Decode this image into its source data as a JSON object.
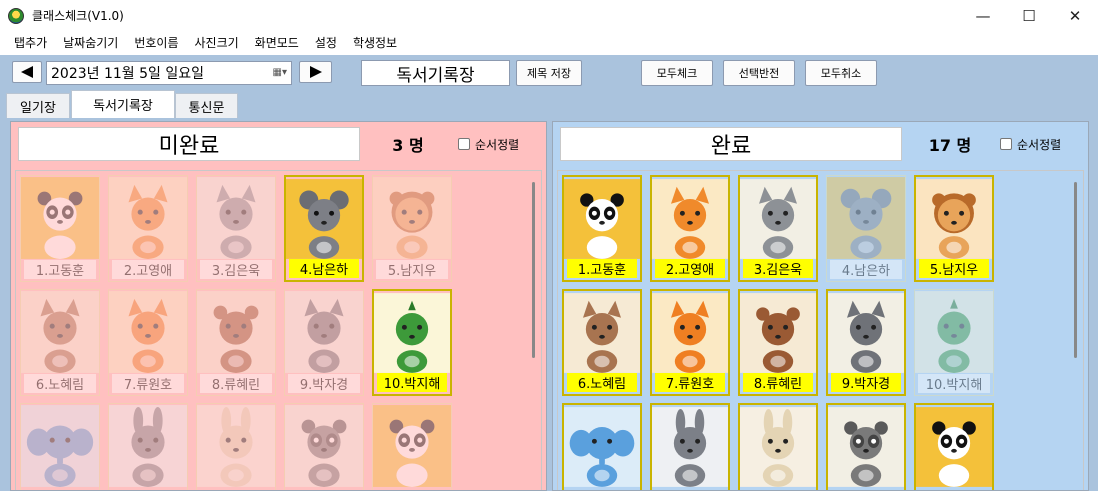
{
  "window": {
    "title": "클래스체크(V1.0)"
  },
  "menu": [
    "탭추가",
    "날짜숨기기",
    "번호이름",
    "사진크기",
    "화면모드",
    "설정",
    "학생정보"
  ],
  "toolbar": {
    "date": "2023년 11월   5일  일요일",
    "title_field": "독서기록장",
    "save_title": "제목 저장",
    "check_all": "모두체크",
    "invert": "선택반전",
    "cancel_all": "모두취소"
  },
  "tabs": [
    "일기장",
    "독서기록장",
    "통신문"
  ],
  "incomplete": {
    "label": "미완료",
    "count": "3 명",
    "sort_label": "순서정렬",
    "cards": [
      {
        "name": "1.고동훈",
        "animal": "panda",
        "checked": false
      },
      {
        "name": "2.고영애",
        "animal": "cat-orange",
        "checked": false
      },
      {
        "name": "3.김은욱",
        "animal": "cat-gray",
        "checked": false
      },
      {
        "name": "4.남은하",
        "animal": "koala",
        "checked": true
      },
      {
        "name": "5.남지우",
        "animal": "lion",
        "checked": false
      },
      {
        "name": "6.노혜림",
        "animal": "squirrel",
        "checked": false
      },
      {
        "name": "7.류원호",
        "animal": "fox",
        "checked": false
      },
      {
        "name": "8.류혜린",
        "animal": "chipmunk",
        "checked": false
      },
      {
        "name": "9.박자경",
        "animal": "wolf",
        "checked": false
      },
      {
        "name": "10.박지해",
        "animal": "dino",
        "checked": true
      },
      {
        "name": "",
        "animal": "elephant",
        "checked": false
      },
      {
        "name": "",
        "animal": "rabbit",
        "checked": false
      },
      {
        "name": "",
        "animal": "rabbit-tan",
        "checked": false
      },
      {
        "name": "",
        "animal": "raccoon",
        "checked": false
      },
      {
        "name": "",
        "animal": "panda",
        "checked": false
      }
    ]
  },
  "complete": {
    "label": "완료",
    "count": "17 명",
    "sort_label": "순서정렬",
    "cards": [
      {
        "name": "1.고동훈",
        "animal": "panda",
        "checked": true
      },
      {
        "name": "2.고영애",
        "animal": "cat-orange",
        "checked": true
      },
      {
        "name": "3.김은욱",
        "animal": "cat-gray",
        "checked": true
      },
      {
        "name": "4.남은하",
        "animal": "koala",
        "checked": false
      },
      {
        "name": "5.남지우",
        "animal": "lion",
        "checked": true
      },
      {
        "name": "6.노혜림",
        "animal": "squirrel",
        "checked": true
      },
      {
        "name": "7.류원호",
        "animal": "fox",
        "checked": true
      },
      {
        "name": "8.류혜린",
        "animal": "chipmunk",
        "checked": true
      },
      {
        "name": "9.박자경",
        "animal": "wolf",
        "checked": true
      },
      {
        "name": "10.박지해",
        "animal": "dino",
        "checked": false
      },
      {
        "name": "",
        "animal": "elephant",
        "checked": true
      },
      {
        "name": "",
        "animal": "rabbit",
        "checked": true
      },
      {
        "name": "",
        "animal": "rabbit-tan",
        "checked": true
      },
      {
        "name": "",
        "animal": "raccoon",
        "checked": true
      },
      {
        "name": "",
        "animal": "panda",
        "checked": true
      }
    ]
  },
  "colors": {
    "toolbar_bg": "#aac3dd",
    "incomplete_bg": "#ffc0c0",
    "complete_bg": "#b5d4f2",
    "name_highlight": "#ffff00"
  }
}
